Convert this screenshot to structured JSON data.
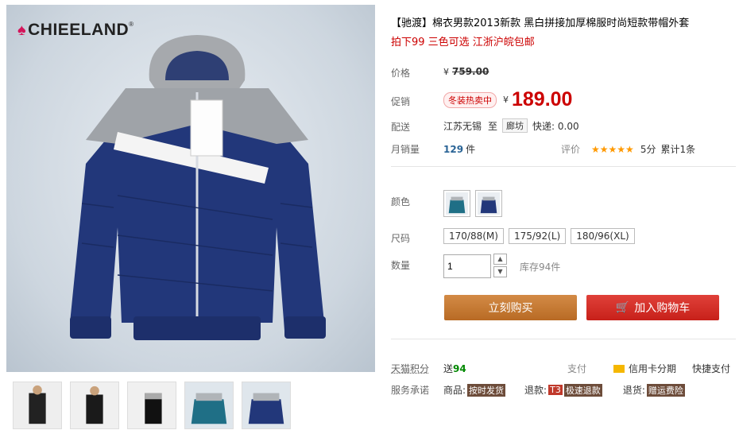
{
  "brand": {
    "name": "CHIEELAND",
    "mark": "®"
  },
  "product": {
    "title": "【驰渡】棉衣男款2013新款 黑白拼接加厚棉服时尚短款带帽外套",
    "subtitle": "拍下99 三色可选 江浙沪皖包邮"
  },
  "price": {
    "label": "价格",
    "currency": "¥",
    "original": "759.00",
    "promo_label": "促销",
    "promo_tag": "冬装热卖中",
    "current": "189.00"
  },
  "shipping": {
    "label": "配送",
    "from": "江苏无锡",
    "to_word": "至",
    "destination": "廊坊",
    "fee_text": "快递: 0.00"
  },
  "sales": {
    "label": "月销量",
    "count": "129",
    "unit": "件",
    "rating_label": "评价",
    "stars": "★★★★★",
    "score": "5分",
    "reviews": "累计1条"
  },
  "options": {
    "color_label": "颜色",
    "colors": [
      "teal",
      "navy"
    ],
    "size_label": "尺码",
    "sizes": [
      "170/88(M)",
      "175/92(L)",
      "180/96(XL)"
    ],
    "qty_label": "数量",
    "qty_value": "1",
    "stock_text": "库存94件"
  },
  "actions": {
    "buy_now": "立刻购买",
    "add_cart": "加入购物车"
  },
  "points": {
    "label": "天猫积分",
    "send": "送",
    "value": "94",
    "pay_label": "支付",
    "credit": "信用卡分期",
    "fast_pay": "快捷支付"
  },
  "service": {
    "label": "服务承诺",
    "goods": "商品:",
    "goods_tag": "按时发货",
    "refund": "退款:",
    "refund_badge": "T3",
    "refund_tag": "极速退款",
    "return": "退货:",
    "return_tag": "赠运费险"
  },
  "colors": {
    "accent_red": "#cc0000",
    "buy_btn": "#c77a34",
    "cart_btn": "#d62e26"
  }
}
